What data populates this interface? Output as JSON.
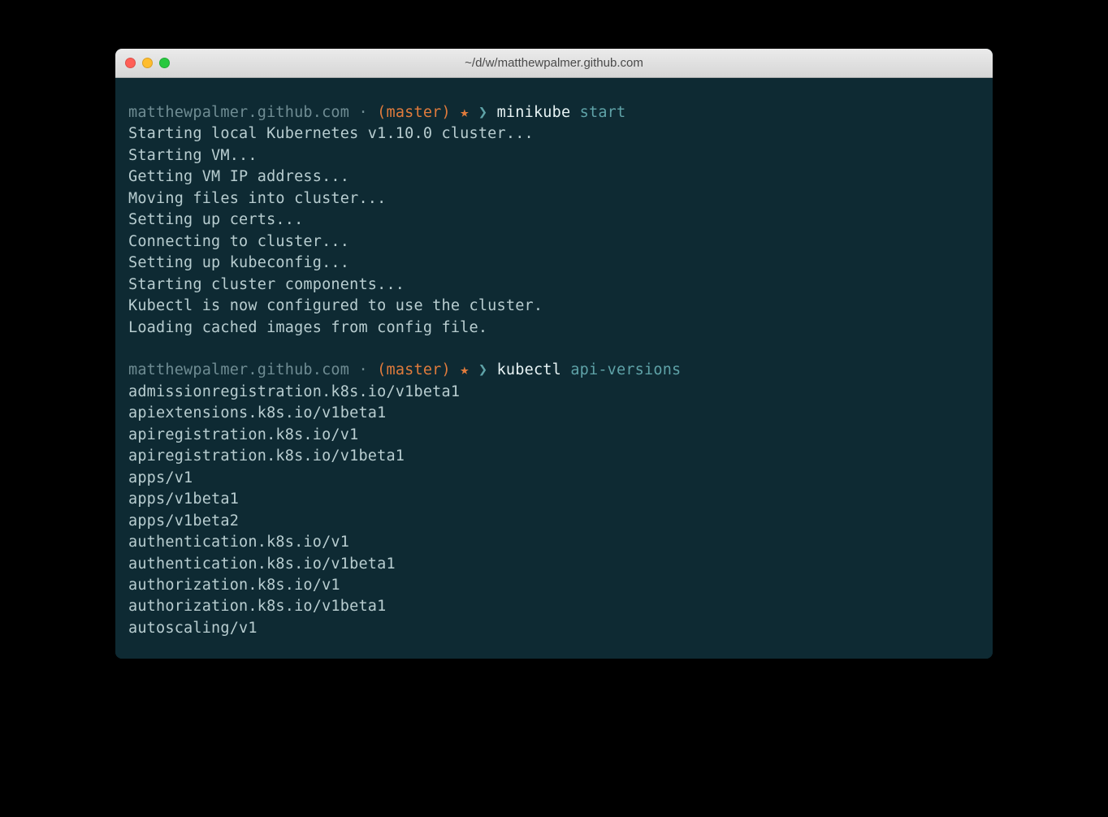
{
  "window": {
    "title": "~/d/w/matthewpalmer.github.com"
  },
  "colors": {
    "bg": "#0e2a33",
    "path": "#6f8c93",
    "branch": "#e07b3c",
    "chevron": "#5fa3a8",
    "command": "#e8f4f5",
    "arg": "#5fa3a8",
    "output": "#b8cdd0"
  },
  "prompt1": {
    "path": "matthewpalmer.github.com",
    "dot": "·",
    "branch": "(master)",
    "star": "★",
    "chevron": "❯",
    "command": "minikube",
    "arg": "start"
  },
  "output1": [
    "Starting local Kubernetes v1.10.0 cluster...",
    "Starting VM...",
    "Getting VM IP address...",
    "Moving files into cluster...",
    "Setting up certs...",
    "Connecting to cluster...",
    "Setting up kubeconfig...",
    "Starting cluster components...",
    "Kubectl is now configured to use the cluster.",
    "Loading cached images from config file."
  ],
  "prompt2": {
    "path": "matthewpalmer.github.com",
    "dot": "·",
    "branch": "(master)",
    "star": "★",
    "chevron": "❯",
    "command": "kubectl",
    "arg": "api-versions"
  },
  "output2": [
    "admissionregistration.k8s.io/v1beta1",
    "apiextensions.k8s.io/v1beta1",
    "apiregistration.k8s.io/v1",
    "apiregistration.k8s.io/v1beta1",
    "apps/v1",
    "apps/v1beta1",
    "apps/v1beta2",
    "authentication.k8s.io/v1",
    "authentication.k8s.io/v1beta1",
    "authorization.k8s.io/v1",
    "authorization.k8s.io/v1beta1",
    "autoscaling/v1"
  ]
}
